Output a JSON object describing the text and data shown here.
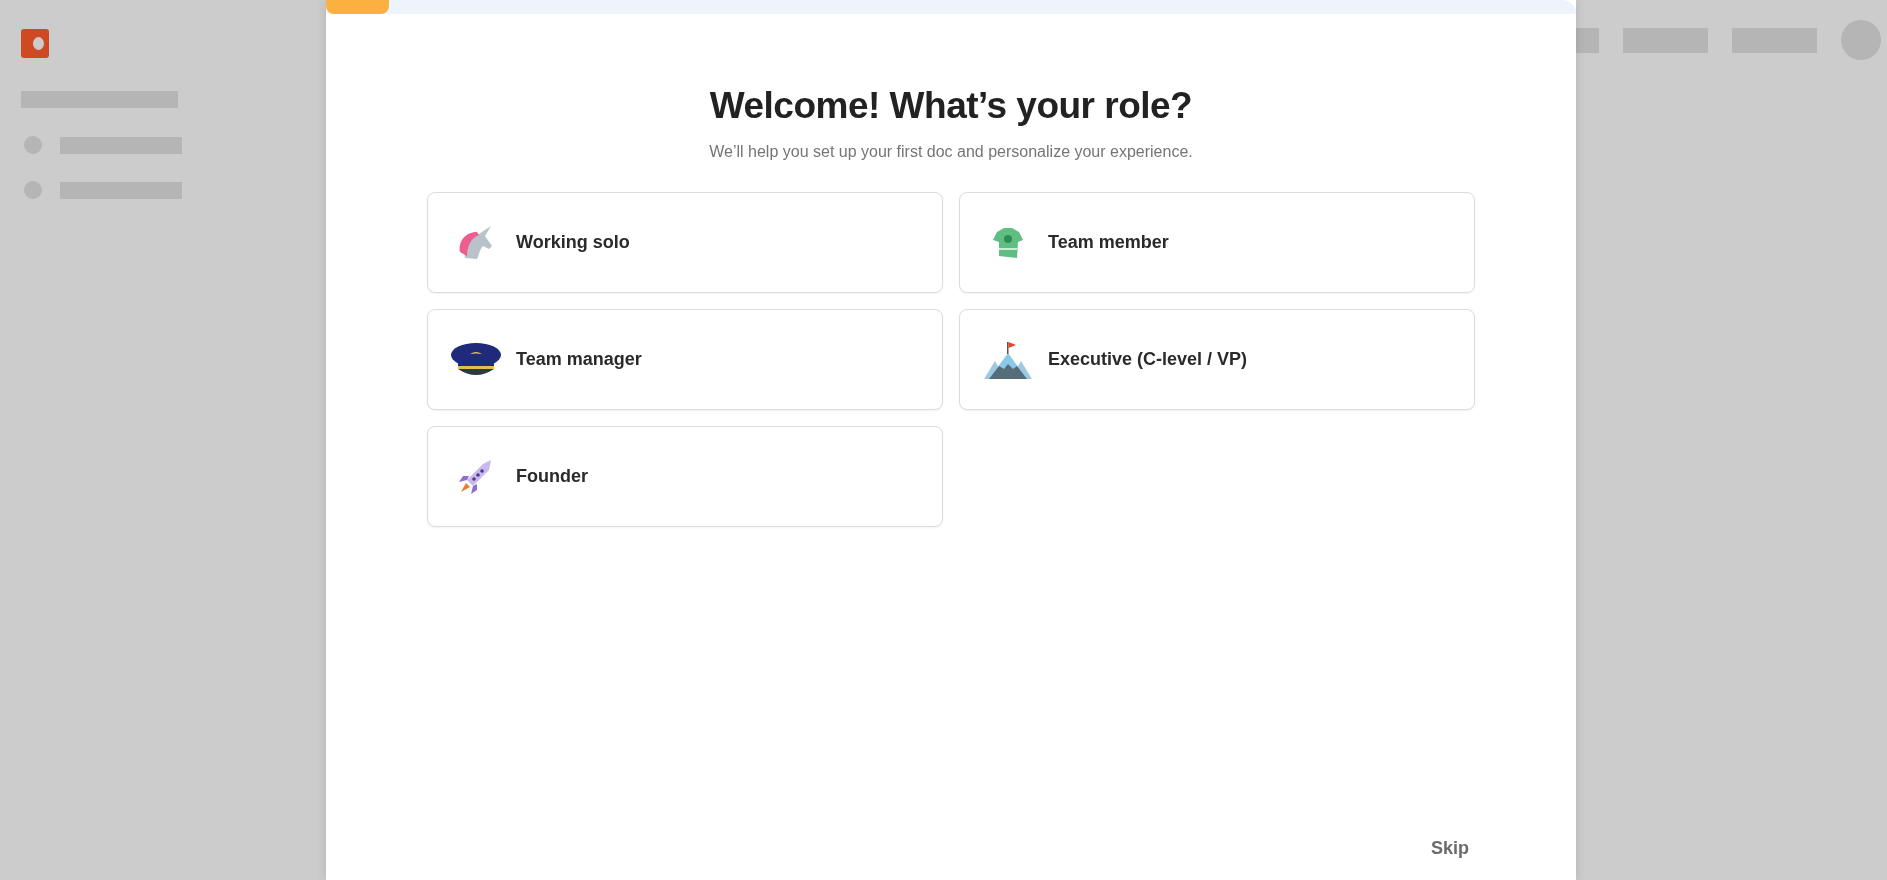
{
  "onboarding": {
    "progress": {
      "level": 0.05
    },
    "title": "Welcome! What’s your role?",
    "subtitle": "We’ll help you set up your first doc and personalize your experience.",
    "roles": [
      {
        "label": "Working solo"
      },
      {
        "label": "Team member"
      },
      {
        "label": "Team manager"
      },
      {
        "label": "Executive (C-level / VP)"
      },
      {
        "label": "Founder"
      }
    ],
    "skip": "Skip"
  }
}
